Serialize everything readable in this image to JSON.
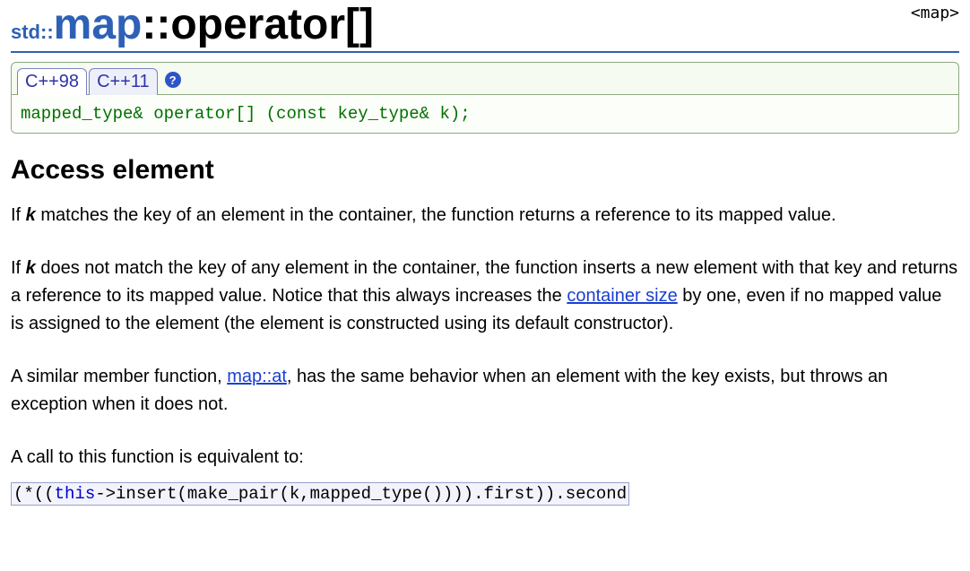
{
  "header": {
    "prefix": "std::",
    "main": "map",
    "suffix": "::operator[]",
    "include": "<map>"
  },
  "tabs": {
    "items": [
      "C++98",
      "C++11"
    ],
    "help": "?"
  },
  "signature": "mapped_type& operator[] (const key_type& k);",
  "section_title": "Access element",
  "p1_a": "If ",
  "p1_k": "k",
  "p1_b": " matches the key of an element in the container, the function returns a reference to its mapped value.",
  "p2_a": "If ",
  "p2_k": "k",
  "p2_b": " does not match the key of any element in the container, the function inserts a new element with that key and returns a reference to its mapped value. Notice that this always increases the ",
  "p2_link": "container size",
  "p2_c": " by one, even if no mapped value is assigned to the element (the element is constructed using its default constructor).",
  "p3_a": "A similar member function, ",
  "p3_link": "map::at",
  "p3_b": ", has the same behavior when an element with the key exists, but throws an exception when it does not.",
  "p4": "A call to this function is equivalent to:",
  "equiv_pre": "(*((",
  "equiv_kw": "this",
  "equiv_post": "->insert(make_pair(k,mapped_type()))).first)).second"
}
